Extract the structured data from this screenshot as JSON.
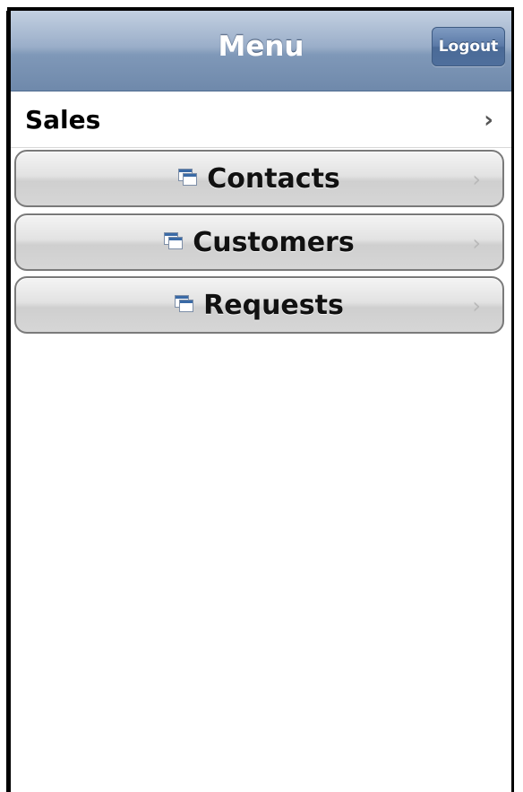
{
  "header": {
    "title": "Menu",
    "logout_label": "Logout"
  },
  "sales": {
    "label": "Sales",
    "chevron": "›"
  },
  "groups": [
    {
      "label": "Contacts",
      "icon": "document-icon",
      "chevron": "›"
    },
    {
      "label": "Customers",
      "icon": "document-icon",
      "chevron": "›"
    },
    {
      "label": "Requests",
      "icon": "document-icon",
      "chevron": "›"
    }
  ],
  "colors": {
    "header_top": "#c3d0e1",
    "header_bottom": "#6f89ab",
    "logout_bg": "#5b7aa7",
    "group_bg": "#dcdcdc",
    "icon_accent": "#3a6aa6"
  }
}
